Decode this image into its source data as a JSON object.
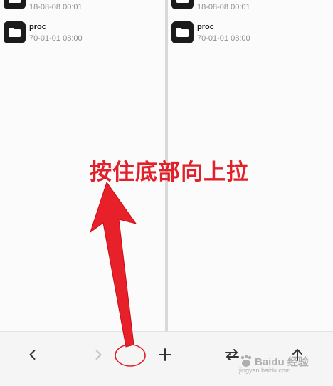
{
  "left_pane": {
    "items": [
      {
        "name": "",
        "date": "18-08-08 00:01",
        "icon": "folder-icon"
      },
      {
        "name": "proc",
        "date": "70-01-01 08:00",
        "icon": "folder-icon"
      }
    ]
  },
  "right_pane": {
    "items": [
      {
        "name": "",
        "date": "18-08-08 00:01",
        "icon": "folder-icon"
      },
      {
        "name": "proc",
        "date": "70-01-01 08:00",
        "icon": "folder-icon"
      }
    ]
  },
  "bottom_bar": {
    "buttons": [
      {
        "name": "back",
        "icon": "chevron-left-icon",
        "enabled": true
      },
      {
        "name": "forward",
        "icon": "chevron-right-icon",
        "enabled": false
      },
      {
        "name": "add",
        "icon": "plus-icon",
        "enabled": true
      },
      {
        "name": "swap",
        "icon": "swap-arrows-icon",
        "enabled": true
      },
      {
        "name": "up",
        "icon": "arrow-up-icon",
        "enabled": true
      }
    ]
  },
  "annotation": {
    "text": "按住底部向上拉",
    "color": "#e2202a"
  },
  "watermark": {
    "main": "Baidu 经验",
    "sub": "jingyan.baidu.com"
  }
}
